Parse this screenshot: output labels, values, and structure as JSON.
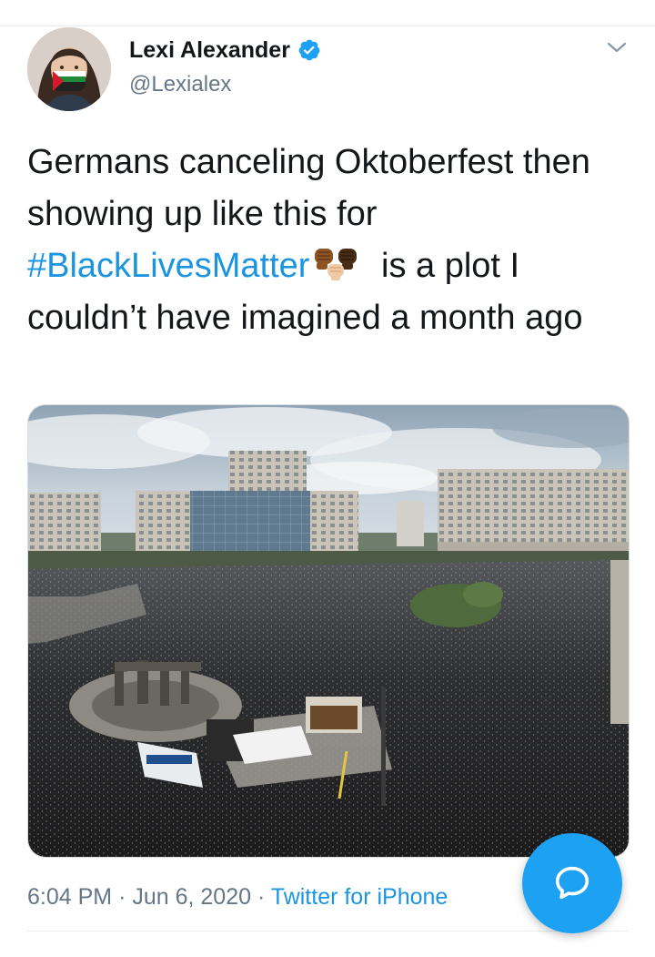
{
  "user": {
    "name": "Lexi Alexander",
    "handle": "@Lexialex",
    "verified": true
  },
  "tweet": {
    "text_part1": "Germans canceling Oktoberfest then showing up like this for ",
    "hashtag": "#BlackLivesMatter",
    "emoji": "✊🏾✊🏿✊🏼",
    "text_part2": " is a plot I couldn’t have imagined a month ago"
  },
  "footer": {
    "time": "6:04 PM",
    "sep1": "·",
    "date": "Jun 6, 2020",
    "sep2": "·",
    "source": "Twitter for iPhone"
  },
  "icons": {
    "verified": "verified-badge-icon",
    "caret": "chevron-down-icon",
    "fab": "compose-reply-icon"
  },
  "colors": {
    "accent": "#1da1f2",
    "link": "#1b95e0",
    "muted": "#657786",
    "text": "#14171a"
  }
}
